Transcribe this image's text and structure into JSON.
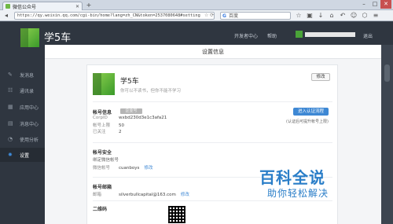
{
  "browser": {
    "tab_title": "微信公众号",
    "url": "https://qy.weixin.qq.com/cgi-bin/home?lang=zh_CN&token=2537080648#setting",
    "search_engine_label": "G",
    "search_placeholder": "百度",
    "new_tab": "+",
    "win_min": "–",
    "win_max": "□",
    "win_close": "✕"
  },
  "header": {
    "app_name": "学5车",
    "link_dev": "开发者中心",
    "link_help": "帮助",
    "logout": "退出"
  },
  "sidebar": {
    "items": [
      {
        "label": "发消息",
        "icon": "pen-icon"
      },
      {
        "label": "通讯录",
        "icon": "contacts-icon"
      },
      {
        "label": "应用中心",
        "icon": "apps-icon"
      },
      {
        "label": "消息中心",
        "icon": "message-icon"
      },
      {
        "label": "使用分析",
        "icon": "analytics-icon"
      },
      {
        "label": "设置",
        "icon": "gear-icon"
      }
    ]
  },
  "main": {
    "page_title": "设置信息",
    "card": {
      "name": "学5车",
      "slogan": "你可以不读书，但你不能不学习",
      "edit_label": "修改",
      "account_section": "帐号信息",
      "badge": "企业号",
      "corp_id_label": "CorpID",
      "corp_id_value": "wxbd230d3e1c3afa21",
      "limit_label": "帐号上限",
      "limit_value": "50",
      "used_label": "已关注",
      "used_value": "2",
      "verify_button": "进入认证流程",
      "verify_note": "(认证后可提升帐号上限)",
      "security_section": "帐号安全",
      "bind_wechat_label": "绑定微信帐号",
      "wechat_label": "微信帐号",
      "wechat_value": "cuanboys",
      "wechat_modify": "修改",
      "email_section": "帐号邮箱",
      "email_label": "邮箱",
      "email_value": "silverbullcapital@163.com",
      "email_modify": "修改",
      "qr_section": "二维码"
    }
  },
  "watermark": {
    "title": "百科全说",
    "subtitle": "助你轻松解决"
  },
  "colors": {
    "accent": "#3e88d4",
    "sidebar_bg": "#2f3640",
    "brand_green": "#4aa338"
  }
}
